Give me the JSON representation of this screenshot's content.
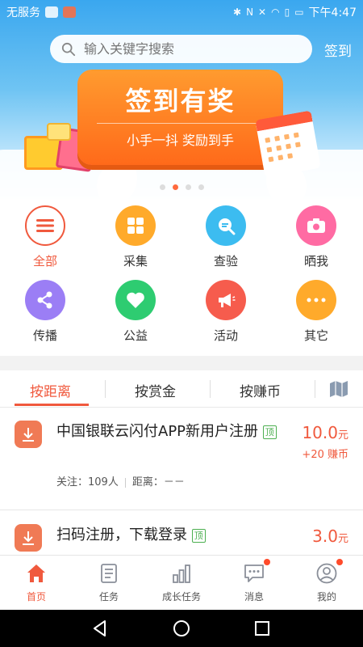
{
  "status_bar": {
    "carrier": "无服务",
    "time": "下午4:47"
  },
  "search": {
    "placeholder": "输入关键字搜索",
    "signin_label": "签到"
  },
  "banner": {
    "title": "签到有奖",
    "subtitle": "小手一抖 奖励到手",
    "page_count": 4,
    "active_page": 1
  },
  "categories": [
    {
      "label": "全部",
      "icon": "menu-icon",
      "color": "#ffffff",
      "active": true
    },
    {
      "label": "采集",
      "icon": "grid-icon",
      "color": "#ffaa2b"
    },
    {
      "label": "查验",
      "icon": "magnifier-chat-icon",
      "color": "#3cbcf0"
    },
    {
      "label": "晒我",
      "icon": "camera-icon",
      "color": "#ff6ba3"
    },
    {
      "label": "传播",
      "icon": "share-icon",
      "color": "#9b7ef5"
    },
    {
      "label": "公益",
      "icon": "heart-icon",
      "color": "#2ecc71"
    },
    {
      "label": "活动",
      "icon": "megaphone-icon",
      "color": "#f65c4d"
    },
    {
      "label": "其它",
      "icon": "more-icon",
      "color": "#ffaa2b"
    }
  ],
  "tabs": [
    {
      "label": "按距离",
      "active": true
    },
    {
      "label": "按赏金"
    },
    {
      "label": "按赚币"
    }
  ],
  "tasks": [
    {
      "title": "中国银联云闪付APP新用户注册",
      "tag": "顶",
      "followers": "关注：109人",
      "distance": "距离：－－",
      "price": "10.0",
      "price_unit": "元",
      "coins": "+20 赚币"
    },
    {
      "title": "扫码注册，下载登录",
      "tag": "顶",
      "price": "3.0",
      "price_unit": "元"
    }
  ],
  "bottom_nav": [
    {
      "label": "首页",
      "icon": "home-icon",
      "active": true
    },
    {
      "label": "任务",
      "icon": "task-list-icon"
    },
    {
      "label": "成长任务",
      "icon": "bar-chart-icon"
    },
    {
      "label": "消息",
      "icon": "message-icon",
      "badge": true
    },
    {
      "label": "我的",
      "icon": "profile-icon",
      "badge": true
    }
  ],
  "colors": {
    "accent": "#f0593d",
    "tag_green": "#4caf50"
  }
}
